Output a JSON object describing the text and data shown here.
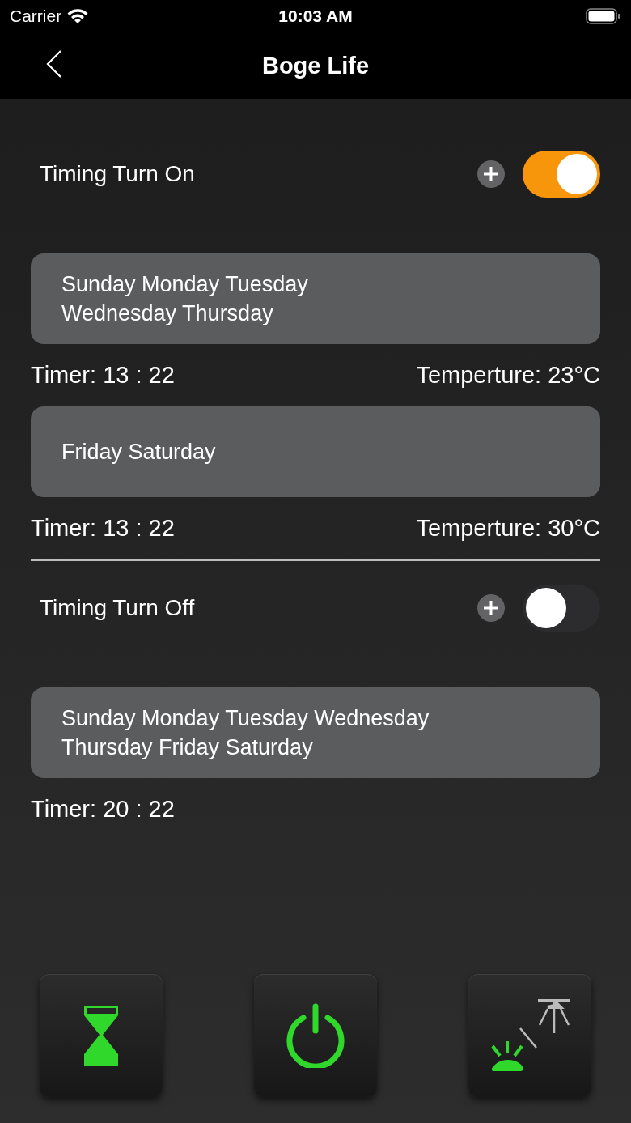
{
  "status_bar": {
    "carrier": "Carrier",
    "time": "10:03 AM"
  },
  "nav": {
    "title": "Boge Life"
  },
  "sections": [
    {
      "title": "Timing Turn On",
      "on": true,
      "schedules": [
        {
          "days": "Sunday Monday Tuesday\nWednesday Thursday",
          "timer": "Timer: 13 : 22",
          "temperature": "Temperture: 23°C"
        },
        {
          "days": "Friday Saturday",
          "timer": "Timer: 13 : 22",
          "temperature": "Temperture: 30°C"
        }
      ]
    },
    {
      "title": "Timing Turn Off",
      "on": false,
      "schedules": [
        {
          "days": "Sunday Monday Tuesday Wednesday\nThursday Friday Saturday",
          "timer": "Timer: 20 : 22"
        }
      ]
    }
  ],
  "bottom_buttons": [
    {
      "kind": "timer"
    },
    {
      "kind": "power"
    },
    {
      "kind": "light"
    }
  ]
}
